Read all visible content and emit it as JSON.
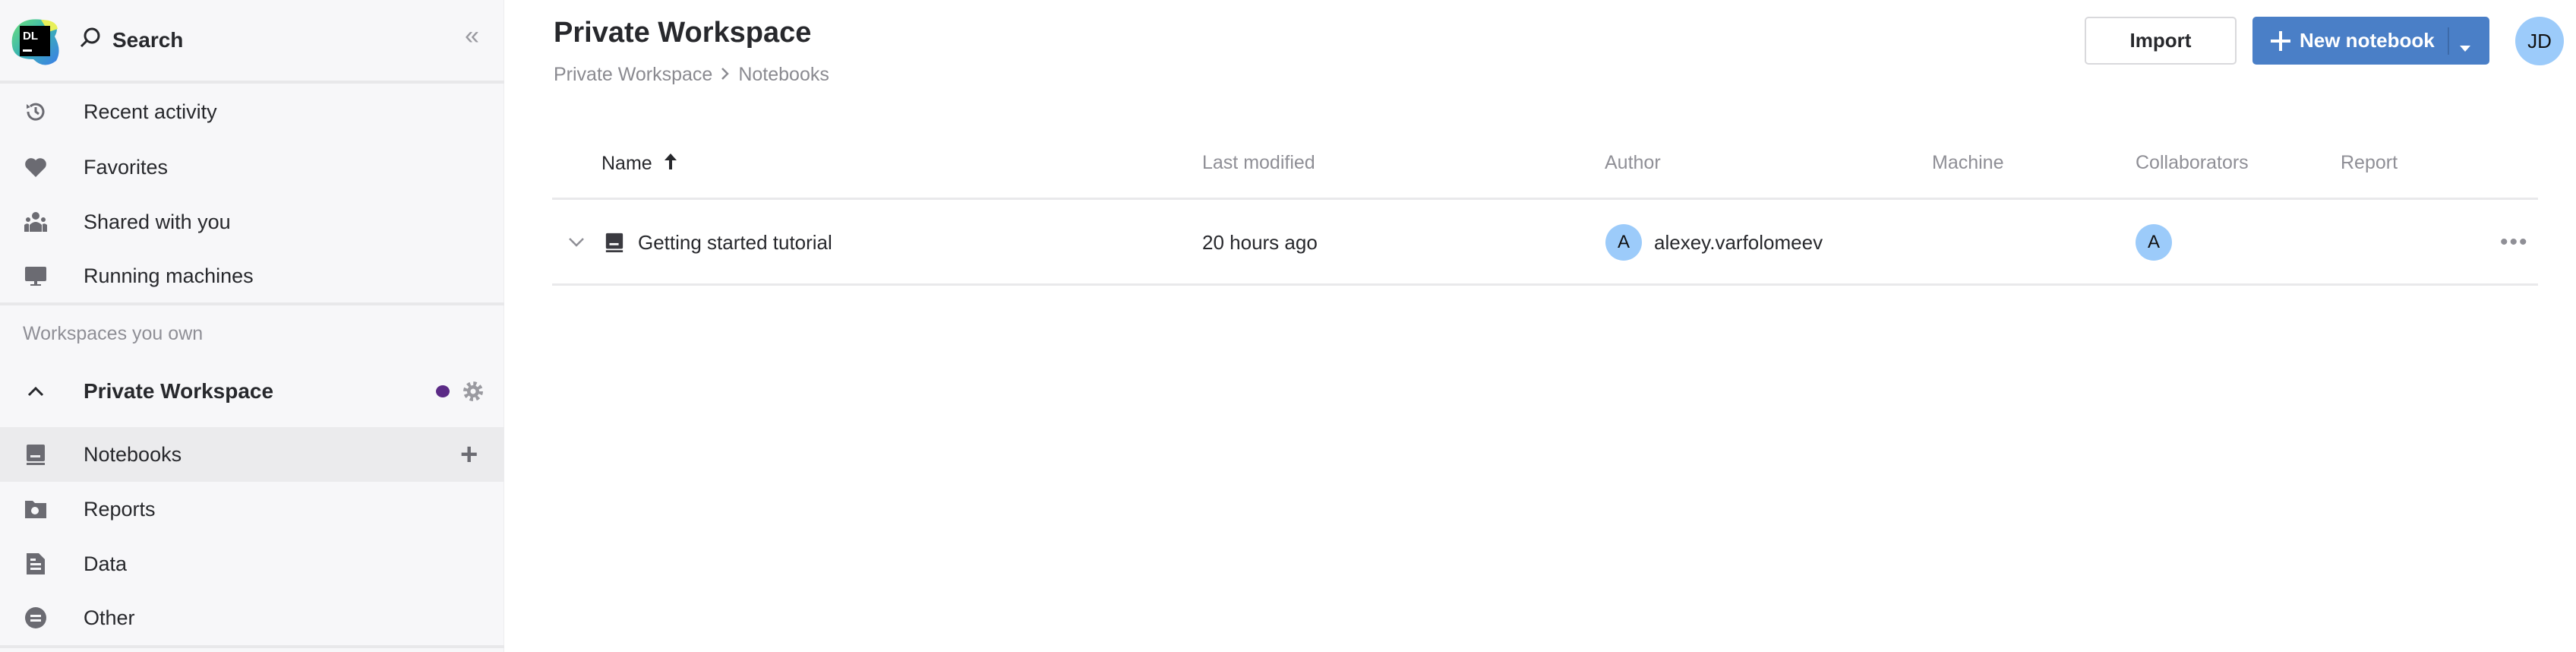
{
  "sidebar": {
    "logo_text": "DL",
    "search_label": "Search",
    "nav": [
      {
        "label": "Recent activity",
        "icon": "history-icon"
      },
      {
        "label": "Favorites",
        "icon": "heart-icon"
      },
      {
        "label": "Shared with you",
        "icon": "people-icon"
      },
      {
        "label": "Running machines",
        "icon": "monitor-icon"
      }
    ],
    "section_label": "Workspaces you own",
    "workspace": {
      "name": "Private Workspace",
      "status_color": "#5b2a86"
    },
    "workspace_items": [
      {
        "label": "Notebooks",
        "icon": "notebook-icon",
        "selected": true
      },
      {
        "label": "Reports",
        "icon": "reports-folder-icon"
      },
      {
        "label": "Data",
        "icon": "data-file-icon"
      },
      {
        "label": "Other",
        "icon": "other-icon"
      }
    ]
  },
  "header": {
    "title": "Private Workspace",
    "breadcrumb": [
      "Private Workspace",
      "Notebooks"
    ],
    "import_label": "Import",
    "new_notebook_label": "New notebook",
    "user_initials": "JD"
  },
  "table": {
    "columns": [
      "Name",
      "Last modified",
      "Author",
      "Machine",
      "Collaborators",
      "Report"
    ],
    "sort": {
      "column": "Name",
      "direction": "ascending"
    },
    "rows": [
      {
        "name": "Getting started tutorial",
        "last_modified": "20 hours ago",
        "author_initial": "A",
        "author": "alexey.varfolomeev",
        "machine": "",
        "collaborator_initial": "A",
        "report": ""
      }
    ]
  },
  "colors": {
    "accent": "#4a7fc7",
    "avatar": "#9ccbfa",
    "sidebar_bg": "#f7f7f9"
  }
}
